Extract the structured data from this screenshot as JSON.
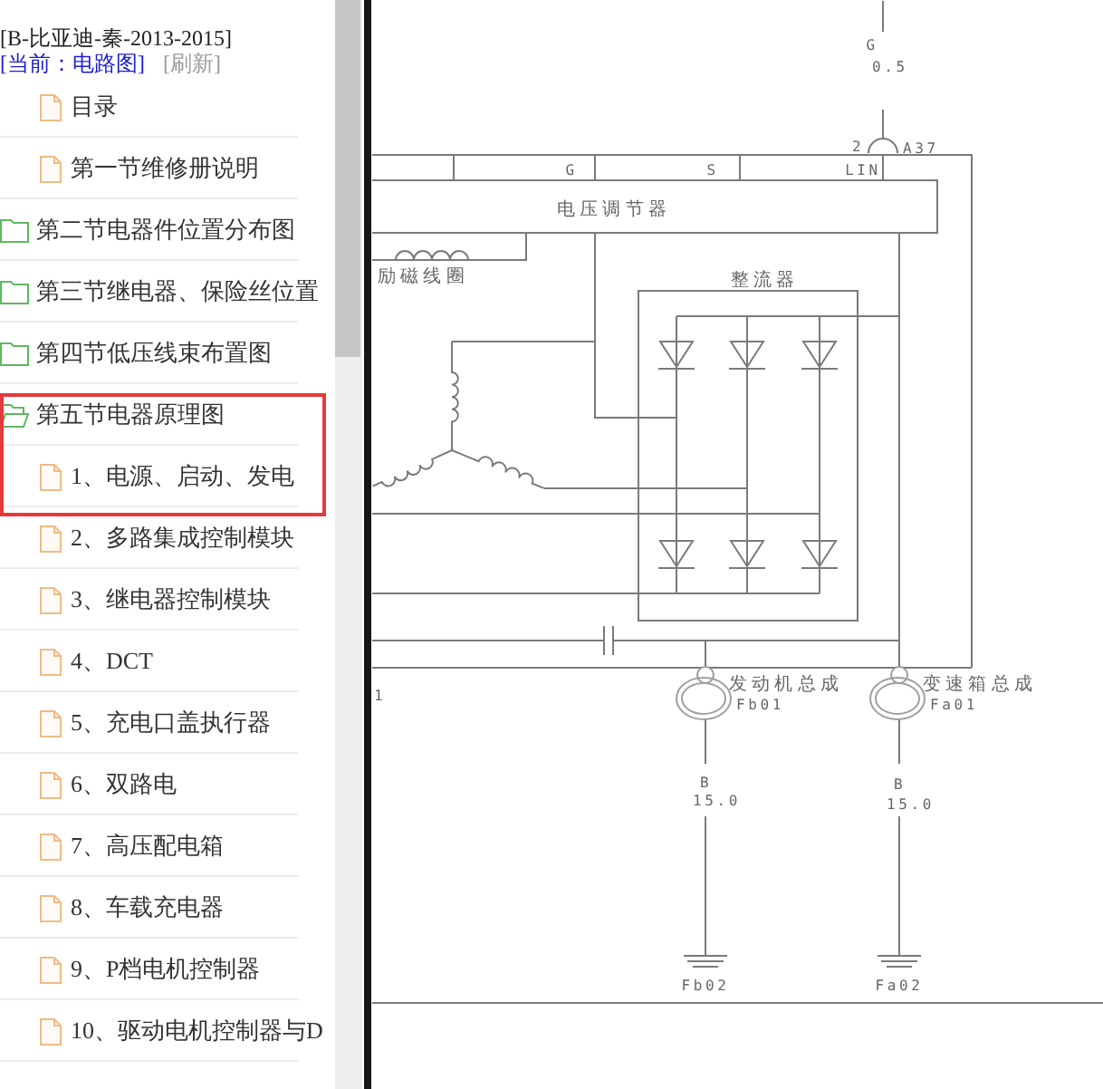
{
  "sidebar": {
    "title": "[B-比亚迪-秦-2013-2015]",
    "current": "[当前：电路图]",
    "refresh": "[刷新]",
    "tree": [
      {
        "kind": "file",
        "label": "目录",
        "highlighted": false
      },
      {
        "kind": "file",
        "label": "第一节维修册说明",
        "highlighted": false
      },
      {
        "kind": "folder",
        "label": "第二节电器件位置分布图",
        "expanded": false,
        "highlighted": false
      },
      {
        "kind": "folder",
        "label": "第三节继电器、保险丝位置",
        "expanded": false,
        "highlighted": false
      },
      {
        "kind": "folder",
        "label": "第四节低压线束布置图",
        "expanded": false,
        "highlighted": false
      },
      {
        "kind": "folder",
        "label": "第五节电器原理图",
        "expanded": true,
        "highlighted": true,
        "children": [
          {
            "kind": "file",
            "label": "1、电源、启动、发电",
            "highlighted": true
          },
          {
            "kind": "file",
            "label": "2、多路集成控制模块",
            "highlighted": false
          },
          {
            "kind": "file",
            "label": "3、继电器控制模块",
            "highlighted": false
          },
          {
            "kind": "file",
            "label": "4、DCT",
            "highlighted": false
          },
          {
            "kind": "file",
            "label": "5、充电口盖执行器",
            "highlighted": false
          },
          {
            "kind": "file",
            "label": "6、双路电",
            "highlighted": false
          },
          {
            "kind": "file",
            "label": "7、高压配电箱",
            "highlighted": false
          },
          {
            "kind": "file",
            "label": "8、车载充电器",
            "highlighted": false
          },
          {
            "kind": "file",
            "label": "9、P档电机控制器",
            "highlighted": false
          },
          {
            "kind": "file",
            "label": "10、驱动电机控制器与D",
            "highlighted": false
          }
        ]
      }
    ]
  },
  "diagram": {
    "supply_wire": {
      "code": "G",
      "gauge": "0.5"
    },
    "supply_connector": {
      "pin": "2",
      "name": "A37"
    },
    "pins": [
      "G",
      "S",
      "LIN"
    ],
    "regulator": "电压调节器",
    "field_coil": "励磁线圈",
    "rectifier": "整流器",
    "edge_label": "1",
    "grounds": [
      {
        "name": "发动机总成",
        "connector": "Fb01",
        "wire_code": "B",
        "gauge": "15.0",
        "ground_point": "Fb02"
      },
      {
        "name": "变速箱总成",
        "connector": "Fa01",
        "wire_code": "B",
        "gauge": "15.0",
        "ground_point": "Fa02"
      }
    ]
  }
}
